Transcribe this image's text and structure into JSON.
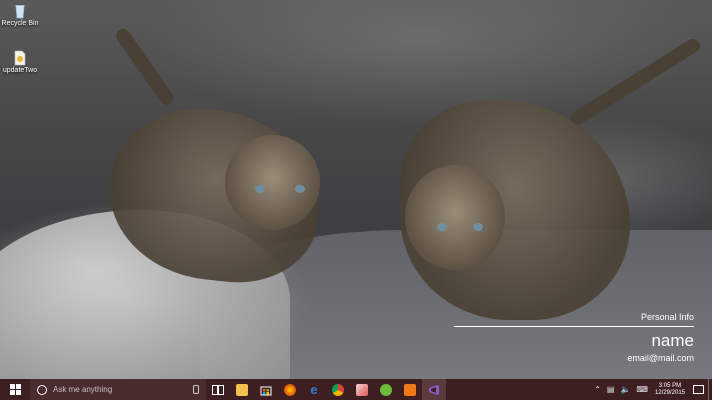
{
  "desktop": {
    "icons": [
      {
        "label": "Recycle Bin",
        "icon": "recycle-bin-icon"
      },
      {
        "label": "updateTwo",
        "icon": "file-icon"
      }
    ]
  },
  "personal_info": {
    "title": "Personal Info",
    "name": "name",
    "email": "email@mail.com"
  },
  "taskbar": {
    "search_placeholder": "Ask me anything",
    "pinned": [
      {
        "name": "task-view",
        "color": "#ffffff"
      },
      {
        "name": "file-explorer",
        "color": "#f2c14e"
      },
      {
        "name": "store",
        "color": "#ffffff"
      },
      {
        "name": "firefox",
        "color": "#e66000"
      },
      {
        "name": "edge",
        "color": "#2f7cd3"
      },
      {
        "name": "chrome",
        "color": "#4caf50"
      },
      {
        "name": "paint",
        "color": "#e05a5a"
      },
      {
        "name": "utorrent",
        "color": "#6dbb3a"
      },
      {
        "name": "app-orange",
        "color": "#f07a1a"
      },
      {
        "name": "visual-studio",
        "color": "#8a5ac8"
      }
    ],
    "clock_time": "3:05 PM",
    "clock_date": "12/29/2015"
  },
  "colors": {
    "taskbar": "#3d1f22",
    "accent": "#5a3a3d"
  }
}
